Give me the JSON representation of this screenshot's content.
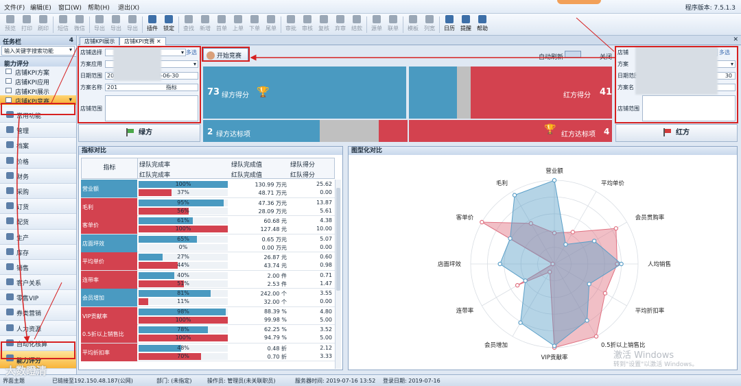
{
  "menu": {
    "items": [
      "文件(F)",
      "编辑(E)",
      "窗口(W)",
      "帮助(H)",
      "退出(X)"
    ],
    "version": "程序版本: 7.5.1.3"
  },
  "toolbar": [
    {
      "label": "预览",
      "on": false
    },
    {
      "label": "打印",
      "on": false
    },
    {
      "label": "刷印",
      "on": false
    },
    {
      "label": "短信",
      "on": false
    },
    {
      "label": "微信",
      "on": false
    },
    {
      "label": "导出",
      "on": false
    },
    {
      "label": "导出",
      "on": false
    },
    {
      "label": "导出",
      "on": false
    },
    {
      "label": "插件",
      "on": true
    },
    {
      "label": "锁定",
      "on": true
    },
    {
      "label": "查找",
      "on": false
    },
    {
      "label": "新增",
      "on": false
    },
    {
      "label": "首单",
      "on": false
    },
    {
      "label": "上单",
      "on": false
    },
    {
      "label": "下单",
      "on": false
    },
    {
      "label": "尾单",
      "on": false
    },
    {
      "label": "审批",
      "on": false
    },
    {
      "label": "审核",
      "on": false
    },
    {
      "label": "复核",
      "on": false
    },
    {
      "label": "弃审",
      "on": false
    },
    {
      "label": "结款",
      "on": false
    },
    {
      "label": "源单",
      "on": false
    },
    {
      "label": "联单",
      "on": false
    },
    {
      "label": "模板",
      "on": false
    },
    {
      "label": "列宽",
      "on": false
    },
    {
      "label": "日历",
      "on": true
    },
    {
      "label": "提醒",
      "on": true
    },
    {
      "label": "帮助",
      "on": true
    }
  ],
  "taskpanel": {
    "title": "任务栏",
    "pin": "4",
    "search_placeholder": "输入关键字搜索功能",
    "section": "能力评分",
    "subs": [
      "店铺KPI方案",
      "店铺KPI应用",
      "店铺KPI展示",
      "店铺KPI竞赛"
    ],
    "cats": [
      "常用功能",
      "管理",
      "档案",
      "价格",
      "财务",
      "采购",
      "订货",
      "配货",
      "生产",
      "库存",
      "销售",
      "客户关系",
      "零售VIP",
      "券类营销",
      "人力资源",
      "自动化核算",
      "能力评分"
    ]
  },
  "tabs": [
    "店铺KPI展示",
    "店铺KPI竞赛"
  ],
  "left_form": {
    "shop_label": "店铺选择",
    "multi": "多选",
    "plan_label": "方案应用",
    "date_label": "日期范围",
    "date_from": "202",
    "date_to": "2019-06-30",
    "name_label": "方案名称",
    "name_val": "201",
    "name_tail": "指标",
    "range_label": "店铺范围",
    "team": "绿方"
  },
  "right_form": {
    "shop_label": "店铺",
    "multi": "多选",
    "plan_label": "方案",
    "date_label": "日期范围",
    "date_to": "30",
    "name_label": "方案名",
    "range_label": "店铺范围",
    "team": "红方"
  },
  "start_button": "开始竞赛",
  "auto_refresh": "自动刷新",
  "close": "关闭",
  "score": {
    "green_points": "73",
    "green_label": "绿方得分",
    "red_points": "41",
    "red_label": "红方得分",
    "green_items": "2",
    "green_items_label": "绿方达标项",
    "red_items": "4",
    "red_items_label": "红方达标项"
  },
  "kpi": {
    "title": "指标对比",
    "col_indicator": "指标",
    "col_rate_g": "绿队完成率",
    "col_rate_r": "红队完成率",
    "col_val_g": "绿队完成值",
    "col_val_r": "红队完成值",
    "col_score_g": "绿队得分",
    "col_score_r": "红队得分",
    "rows": [
      {
        "name": "营业额",
        "winner": "g",
        "g_rate": "100%",
        "g_pct": 100,
        "r_rate": "37%",
        "r_pct": 37,
        "g_val": "130.99 万元",
        "r_val": "48.71 万元",
        "g_score": "25.62",
        "r_score": "0.00"
      },
      {
        "name": "毛利",
        "winner": "r",
        "g_rate": "95%",
        "g_pct": 95,
        "r_rate": "56%",
        "r_pct": 56,
        "g_val": "47.36 万元",
        "r_val": "28.09 万元",
        "g_score": "13.87",
        "r_score": "5.61"
      },
      {
        "name": "客单价",
        "winner": "r",
        "g_rate": "61%",
        "g_pct": 61,
        "r_rate": "100%",
        "r_pct": 100,
        "g_val": "60.68 元",
        "r_val": "127.48 元",
        "g_score": "4.38",
        "r_score": "10.00"
      },
      {
        "name": "店面坪效",
        "winner": "g",
        "g_rate": "65%",
        "g_pct": 65,
        "r_rate": "0%",
        "r_pct": 0,
        "g_val": "0.65 万元",
        "r_val": "0.00 万元",
        "g_score": "5.07",
        "r_score": "0.00"
      },
      {
        "name": "平均单价",
        "winner": "r",
        "g_rate": "27%",
        "g_pct": 27,
        "r_rate": "44%",
        "r_pct": 44,
        "g_val": "26.87 元",
        "r_val": "43.74 元",
        "g_score": "0.60",
        "r_score": "0.98"
      },
      {
        "name": "连带率",
        "winner": "r",
        "g_rate": "40%",
        "g_pct": 40,
        "r_rate": "51%",
        "r_pct": 51,
        "g_val": "2.00 件",
        "r_val": "2.53 件",
        "g_score": "0.71",
        "r_score": "1.47"
      },
      {
        "name": "会员增加",
        "winner": "g",
        "g_rate": "81%",
        "g_pct": 81,
        "r_rate": "11%",
        "r_pct": 11,
        "g_val": "242.00 个",
        "r_val": "32.00 个",
        "g_score": "3.55",
        "r_score": "0.00"
      },
      {
        "name": "VIP贡献率",
        "winner": "r",
        "g_rate": "98%",
        "g_pct": 98,
        "r_rate": "100%",
        "r_pct": 100,
        "g_val": "88.39 %",
        "r_val": "99.98 %",
        "g_score": "4.80",
        "r_score": "5.00"
      },
      {
        "name": "0.5折以上销售比",
        "winner": "r",
        "g_rate": "78%",
        "g_pct": 78,
        "r_rate": "100%",
        "r_pct": 100,
        "g_val": "62.25 %",
        "r_val": "94.79 %",
        "g_score": "3.52",
        "r_score": "5.00"
      },
      {
        "name": "平均折扣率",
        "winner": "r",
        "g_rate": "48%",
        "g_pct": 48,
        "r_rate": "70%",
        "r_pct": 70,
        "g_val": "0.48 折",
        "r_val": "0.70 折",
        "g_score": "2.12",
        "r_score": "3.33"
      }
    ]
  },
  "radar": {
    "title": "图型化对比",
    "axes": [
      "营业额",
      "平均单价",
      "会员贯购率",
      "人均销售",
      "平均折扣率",
      "0.5折以上销售比",
      "VIP贡献率",
      "会员增加",
      "连带率",
      "店面坪效",
      "客单价",
      "毛利"
    ],
    "green": [
      1.0,
      0.27,
      0.55,
      0.8,
      0.48,
      0.78,
      0.98,
      0.81,
      0.4,
      0.65,
      0.61,
      0.95
    ],
    "red": [
      0.37,
      0.44,
      0.85,
      0.75,
      0.7,
      1.0,
      1.0,
      0.11,
      0.51,
      0.02,
      1.0,
      0.56
    ],
    "green_color": "#5a9fc8",
    "red_color": "#e07080"
  },
  "watermark": {
    "line1": "激活 Windows",
    "line2": "转到\"设置\"以激活 Windows。"
  },
  "logo": "大数瞪清",
  "status": {
    "theme": "界面主题",
    "server_conn": "已链接至192.150.48.187(公网)",
    "dept": "部门: (未指定)",
    "operator": "操作员: 管理员(未关联职员)",
    "server_time": "服务器时间: 2019-07-16 13:52",
    "login_date": "登录日期: 2019-07-16"
  },
  "colors": {
    "green": "#4a9ac1",
    "red": "#d3424f",
    "gray": "#c0c0c0"
  }
}
